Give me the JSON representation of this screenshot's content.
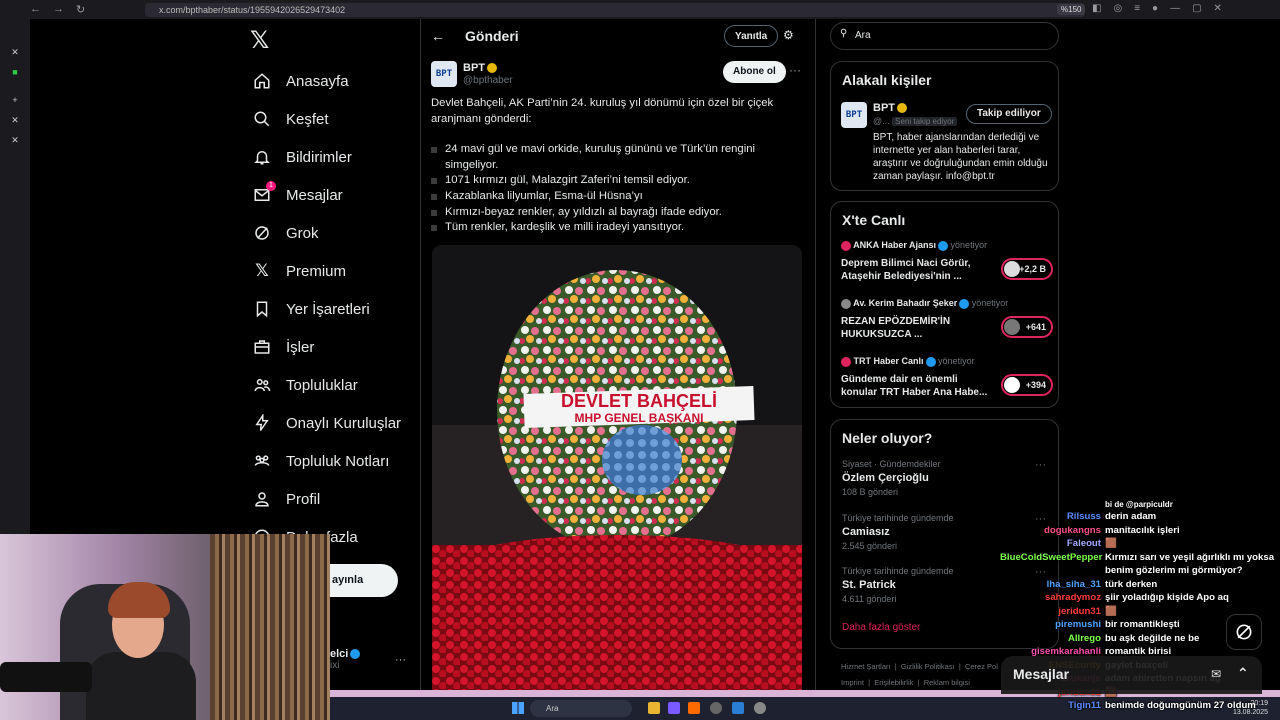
{
  "browser": {
    "url": "x.com/bpthaber/status/1955942026529473402",
    "zoom": "%150"
  },
  "nav": {
    "items": [
      {
        "label": "Anasayfa"
      },
      {
        "label": "Keşfet"
      },
      {
        "label": "Bildirimler"
      },
      {
        "label": "Mesajlar",
        "badge": "1"
      },
      {
        "label": "Grok"
      },
      {
        "label": "Premium"
      },
      {
        "label": "Yer İşaretleri"
      },
      {
        "label": "İşler"
      },
      {
        "label": "Topluluklar"
      },
      {
        "label": "Onaylı Kuruluşlar"
      },
      {
        "label": "Topluluk Notları"
      },
      {
        "label": "Profil"
      },
      {
        "label": "Daha fazla"
      }
    ],
    "post_button": "ayınla",
    "account_name": "elci",
    "account_handle": "ixi"
  },
  "post": {
    "header_title": "Gönderi",
    "reply_button": "Yanıtla",
    "subscribe_button": "Abone ol",
    "author_name": "BPT",
    "author_handle": "@bpthaber",
    "avatar_text": "BPT",
    "intro": "Devlet Bahçeli, AK Parti’nin 24. kuruluş yıl dönümü için özel bir çiçek aranjmanı gönderdi:",
    "bullets": [
      "24 mavi gül ve mavi orkide, kuruluş gününü ve Türk’ün rengini simgeliyor.",
      "1071 kırmızı gül, Malazgirt Zaferi’ni temsil ediyor.",
      "Kazablanka lilyumlar, Esma-ül Hüsna’yı",
      "Kırmızı-beyaz renkler, ay yıldızlı al bayrağı ifade ediyor.",
      "Tüm renkler, kardeşlik ve milli iradeyi yansıtıyor."
    ],
    "banner_line1": "DEVLET BAHÇELİ",
    "banner_line2": "MHP GENEL BAŞKANI"
  },
  "right": {
    "search_placeholder": "Ara",
    "related": {
      "title": "Alakalı kişiler",
      "name": "BPT",
      "handle": "@...",
      "follows_you": "Seni takip ediyor",
      "follow_button": "Takip ediliyor",
      "bio": "BPT, haber ajanslarından derlediği ve internette yer alan haberleri tarar, araştırır ve doğruluğundan emin olduğu zaman paylaşır. info@bpt.tr"
    },
    "live": {
      "title": "X'te Canlı",
      "items": [
        {
          "host": "ANKA Haber Ajansı",
          "role": "yönetiyor",
          "title": "Deprem Bilimci Naci Görür, Ataşehir Belediyesi'nin ...",
          "count": "+2,2 B"
        },
        {
          "host": "Av. Kerim Bahadır Şeker",
          "role": "yönetiyor",
          "title": "REZAN EPÖZDEMİR'İN HUKUKSUZCA ...",
          "count": "+641"
        },
        {
          "host": "TRT Haber Canlı",
          "role": "yönetiyor",
          "title": "Gündeme dair en önemli konular TRT Haber Ana Habe...",
          "count": "+394"
        }
      ]
    },
    "trends": {
      "title": "Neler oluyor?",
      "items": [
        {
          "context": "Siyaset · Gündemdekiler",
          "name": "Özlem Çerçioğlu",
          "count": "108 B gönderi"
        },
        {
          "context": "Türkiye tarihinde gündemde",
          "name": "Camiasız",
          "count": "2.545 gönderi"
        },
        {
          "context": "Türkiye tarihinde gündemde",
          "name": "St. Patrick",
          "count": "4.611 gönderi"
        }
      ],
      "show_more": "Daha fazla göster"
    },
    "footer": {
      "links": [
        "Hizmet Şartları",
        "Gizlilik Politikası",
        "Çerez Pol",
        "Imprint",
        "Erişilebilirlik",
        "Reklam bilgisi"
      ]
    }
  },
  "chat": {
    "top_fragment": "bi de @parpiculdr",
    "messages": [
      {
        "user": "Rilsuss",
        "color": "#5b8cff",
        "text": "derin adam"
      },
      {
        "user": "dogukangns",
        "color": "#ff4f8b",
        "text": "manitacılık işleri"
      },
      {
        "user": "Faleout",
        "color": "#a0a8ff",
        "text": "🟫"
      },
      {
        "user": "BlueColdSweetPepper",
        "color": "#7dff4d",
        "text": "Kırmızı sarı ve yeşil ağırlıklı mı yoksa benim gözlerim mi görmüyor?"
      },
      {
        "user": "lha_siha_31",
        "color": "#4da3ff",
        "text": "türk derken"
      },
      {
        "user": "sahradymoz",
        "color": "#ff3b3b",
        "text": "şiir yoladığıp kişide Apo aq"
      },
      {
        "user": "jeridun31",
        "color": "#ff3b3b",
        "text": "🟫"
      },
      {
        "user": "piremushi",
        "color": "#4da3ff",
        "text": "bir romantikleşti"
      },
      {
        "user": "Allrego",
        "color": "#7dff4d",
        "text": "bu aşk değilde ne be"
      },
      {
        "user": "gisemkarahanli",
        "color": "#ff4fb0",
        "text": "romantik birisi"
      },
      {
        "user": "ENSEcurity",
        "color": "#ffb020",
        "text": "gaylet baxçeli"
      },
      {
        "user": "Erukanje",
        "color": "#ff4fb0",
        "text": "adam ahiretten napsın ağ"
      },
      {
        "user": "jeridun31",
        "color": "#ff3b3b",
        "text": "🟫"
      },
      {
        "user": "Tigin11",
        "color": "#5b8cff",
        "text": "benimde doğumgünüm 27 oldum"
      }
    ],
    "dm_label": "Mesajlar"
  },
  "taskbar": {
    "search": "Ara",
    "time": "20:19",
    "date": "13.08.2025"
  }
}
